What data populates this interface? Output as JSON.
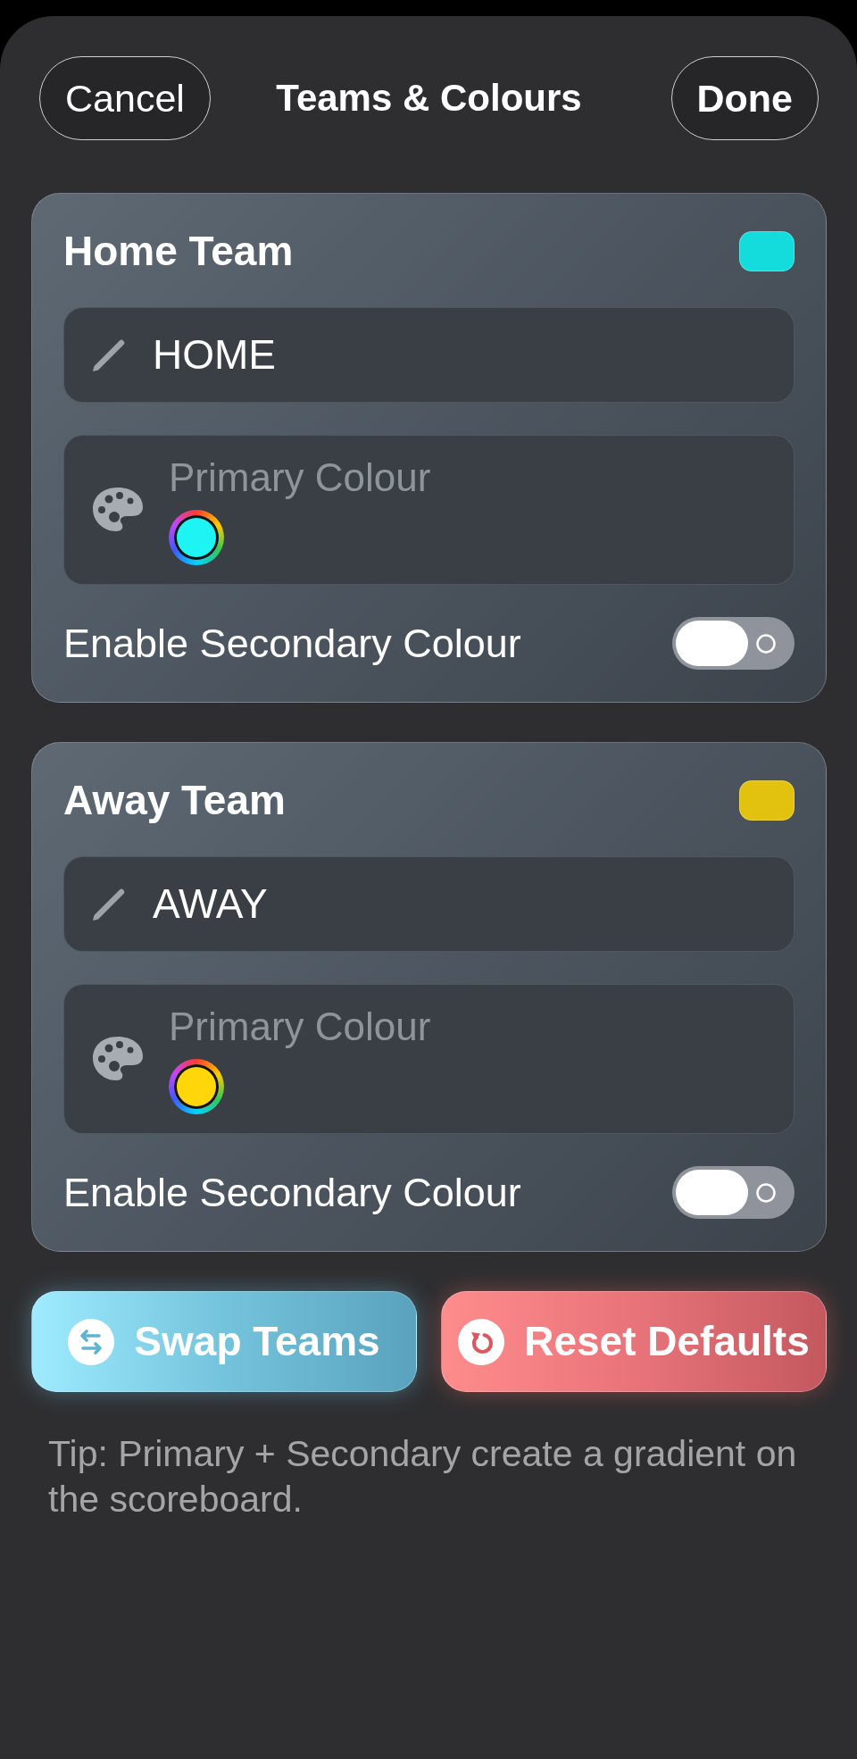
{
  "header": {
    "cancel": "Cancel",
    "title": "Teams & Colours",
    "done": "Done"
  },
  "teams": [
    {
      "title": "Home Team",
      "color": "#14dcdc",
      "name": "HOME",
      "primary": {
        "label": "Primary Colour",
        "color": "#1ff4f4"
      },
      "secondary": {
        "label": "Enable Secondary Colour",
        "on": false
      }
    },
    {
      "title": "Away Team",
      "color": "#e2c20e",
      "name": "AWAY",
      "primary": {
        "label": "Primary Colour",
        "color": "#ffd60a"
      },
      "secondary": {
        "label": "Enable Secondary Colour",
        "on": false
      }
    }
  ],
  "actions": [
    {
      "kind": "swap",
      "label": "Swap Teams"
    },
    {
      "kind": "reset",
      "label": "Reset Defaults"
    }
  ],
  "tip": "Tip: Primary + Secondary create a gradient on the scoreboard."
}
